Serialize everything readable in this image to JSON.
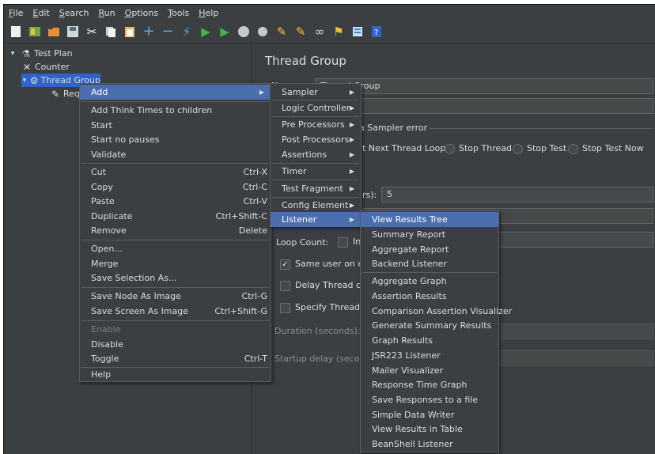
{
  "menubar": [
    {
      "label": "File",
      "u": "F",
      "rest": "ile"
    },
    {
      "label": "Edit",
      "u": "E",
      "rest": "dit"
    },
    {
      "label": "Search",
      "u": "S",
      "rest": "earch"
    },
    {
      "label": "Run",
      "u": "R",
      "rest": "un"
    },
    {
      "label": "Options",
      "u": "O",
      "rest": "ptions"
    },
    {
      "label": "Tools",
      "u": "T",
      "rest": "ools"
    },
    {
      "label": "Help",
      "u": "H",
      "rest": "elp"
    }
  ],
  "toolbar_icons": [
    "new-icon",
    "templates-icon",
    "open-icon",
    "save-icon",
    "cut-icon",
    "copy-icon",
    "paste-icon",
    "expand-icon",
    "collapse-icon",
    "toggle-icon",
    "start-icon",
    "start-no-pauses-icon",
    "stop-icon",
    "shutdown-icon",
    "clear-icon",
    "clear-all-icon",
    "search-icon",
    "reset-search-icon",
    "function-helper-icon",
    "help-icon"
  ],
  "tree": {
    "test_plan": "Test Plan",
    "counter": "Counter",
    "thread_group": "Thread Group",
    "request": "Req"
  },
  "panel": {
    "title": "Thread Group",
    "name_label": "Name:",
    "name_value": "Thread Group",
    "sampler_error": "a Sampler error",
    "options": [
      "t Next Thread Loop",
      "Stop Thread",
      "Stop Test",
      "Stop Test Now"
    ],
    "users_label": "rs):",
    "users_value": "5",
    "loop_count": "Loop Count:",
    "infinite": "Inf",
    "same_user": "Same user on each",
    "delay_thread": "Delay Thread creat",
    "specify_lifetime": "Specify Thread life",
    "duration": "Duration (seconds):",
    "startup_delay": "Startup delay (seconds)"
  },
  "context_menu": {
    "add": "Add",
    "items": [
      {
        "label": "Add Think Times to children",
        "shortcut": ""
      },
      {
        "label": "Start",
        "shortcut": ""
      },
      {
        "label": "Start no pauses",
        "shortcut": ""
      },
      {
        "label": "Validate",
        "shortcut": ""
      },
      {
        "label": "Cut",
        "shortcut": "Ctrl-X"
      },
      {
        "label": "Copy",
        "shortcut": "Ctrl-C"
      },
      {
        "label": "Paste",
        "shortcut": "Ctrl-V"
      },
      {
        "label": "Duplicate",
        "shortcut": "Ctrl+Shift-C"
      },
      {
        "label": "Remove",
        "shortcut": "Delete"
      },
      {
        "label": "Open...",
        "shortcut": ""
      },
      {
        "label": "Merge",
        "shortcut": ""
      },
      {
        "label": "Save Selection As...",
        "shortcut": ""
      },
      {
        "label": "Save Node As Image",
        "shortcut": "Ctrl-G"
      },
      {
        "label": "Save Screen As Image",
        "shortcut": "Ctrl+Shift-G"
      },
      {
        "label": "Enable",
        "shortcut": ""
      },
      {
        "label": "Disable",
        "shortcut": ""
      },
      {
        "label": "Toggle",
        "shortcut": "Ctrl-T"
      },
      {
        "label": "Help",
        "shortcut": ""
      }
    ]
  },
  "add_submenu": [
    "Sampler",
    "Logic Controller",
    "Pre Processors",
    "Post Processors",
    "Assertions",
    "Timer",
    "Test Fragment",
    "Config Element",
    "Listener"
  ],
  "listener_submenu": [
    "View Results Tree",
    "Summary Report",
    "Aggregate Report",
    "Backend Listener",
    "Aggregate Graph",
    "Assertion Results",
    "Comparison Assertion Visualizer",
    "Generate Summary Results",
    "Graph Results",
    "JSR223 Listener",
    "Mailer Visualizer",
    "Response Time Graph",
    "Save Responses to a file",
    "Simple Data Writer",
    "View Results in Table",
    "BeanShell Listener"
  ],
  "colors": {
    "bg": "#3c3f41",
    "selection": "#4b6eaf",
    "tree_selection": "#2f65ca"
  }
}
